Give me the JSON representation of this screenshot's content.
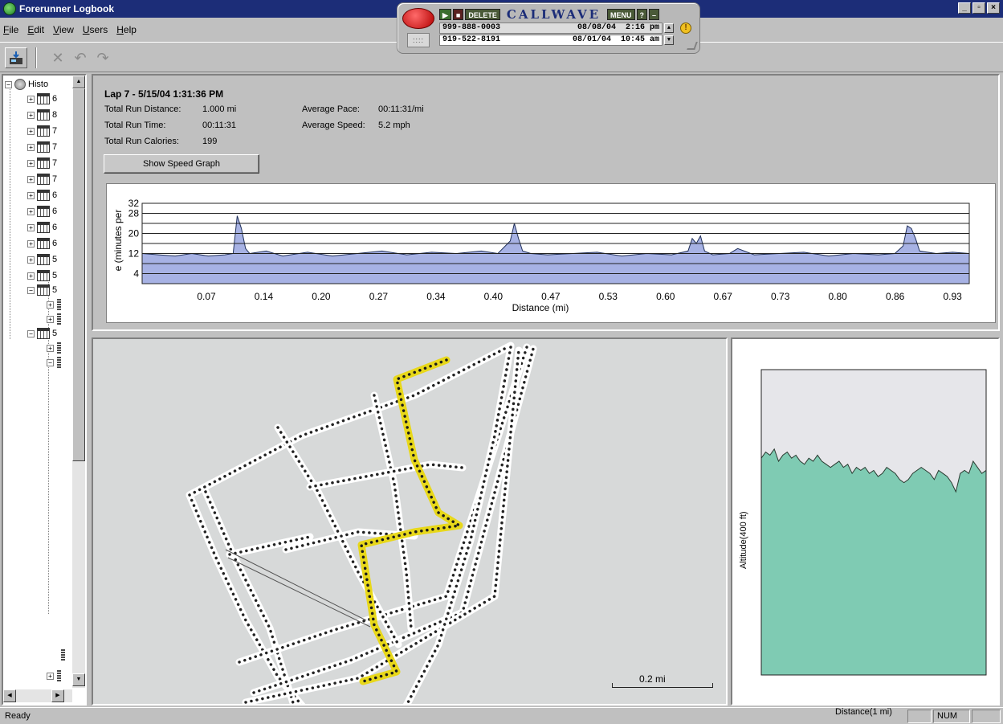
{
  "window": {
    "title": "Forerunner Logbook"
  },
  "menu": [
    {
      "u": "F",
      "rest": "ile"
    },
    {
      "u": "E",
      "rest": "dit"
    },
    {
      "u": "V",
      "rest": "iew"
    },
    {
      "u": "U",
      "rest": "sers"
    },
    {
      "u": "H",
      "rest": "elp"
    }
  ],
  "callwave": {
    "brand": "CALLWAVE",
    "delete_label": "DELETE",
    "menu_label": "MENU",
    "help_label": "?",
    "calls": [
      {
        "number": "999-888-0003",
        "date": "08/08/04",
        "time": "2:16 pm"
      },
      {
        "number": "919-522-8191",
        "date": "08/01/04",
        "time": "10:45 am"
      }
    ]
  },
  "tree": {
    "root_label": "Histo",
    "item_glyphs": [
      "6",
      "8",
      "7",
      "7",
      "7",
      "7",
      "6",
      "6",
      "6",
      "6",
      "5",
      "5",
      "5",
      "5"
    ]
  },
  "lap": {
    "title": "Lap 7 - 5/15/04 1:31:36 PM",
    "total_distance_label": "Total Run Distance:",
    "total_distance_value": "1.000 mi",
    "total_time_label": "Total Run Time:",
    "total_time_value": "00:11:31",
    "total_calories_label": "Total Run Calories:",
    "total_calories_value": "199",
    "avg_pace_label": "Average Pace:",
    "avg_pace_value": "00:11:31/mi",
    "avg_speed_label": "Average Speed:",
    "avg_speed_value": "5.2 mph",
    "show_graph_button": "Show Speed Graph"
  },
  "chart_data": {
    "type": "area",
    "xlabel": "Distance (mi)",
    "ylabel": "e (minutes per",
    "y_ticks": [
      4,
      12,
      20,
      28,
      32
    ],
    "ylim": [
      0,
      32
    ],
    "x_ticks": [
      "0.07",
      "0.14",
      "0.20",
      "0.27",
      "0.34",
      "0.40",
      "0.47",
      "0.53",
      "0.60",
      "0.67",
      "0.73",
      "0.80",
      "0.86",
      "0.93"
    ],
    "xlim": [
      0,
      1.0
    ],
    "fill_color": "#a7b2e4",
    "line_color": "#20305a",
    "x": [
      0.0,
      0.02,
      0.04,
      0.06,
      0.08,
      0.1,
      0.11,
      0.115,
      0.12,
      0.125,
      0.13,
      0.15,
      0.17,
      0.2,
      0.23,
      0.26,
      0.29,
      0.32,
      0.35,
      0.38,
      0.41,
      0.43,
      0.445,
      0.45,
      0.455,
      0.46,
      0.47,
      0.49,
      0.52,
      0.55,
      0.58,
      0.61,
      0.64,
      0.66,
      0.665,
      0.67,
      0.675,
      0.68,
      0.69,
      0.71,
      0.72,
      0.74,
      0.77,
      0.8,
      0.83,
      0.86,
      0.89,
      0.91,
      0.92,
      0.925,
      0.93,
      0.935,
      0.94,
      0.96,
      0.98,
      1.0
    ],
    "y": [
      12,
      11.5,
      11,
      12,
      11,
      11.5,
      12,
      27,
      22,
      14,
      12,
      13,
      11,
      12.5,
      11,
      12,
      13,
      11.5,
      12.5,
      12,
      13,
      12,
      17,
      24,
      18,
      13,
      12,
      11.5,
      12,
      12.5,
      11,
      12,
      11.5,
      13,
      18,
      16,
      19,
      13,
      11.5,
      12,
      14,
      11.5,
      12,
      12.5,
      11,
      12,
      11.5,
      12,
      15,
      23,
      22,
      18,
      13,
      12,
      12.5,
      12
    ]
  },
  "map": {
    "scale_label": "0.2 mi",
    "route_color": "#e8d81a",
    "track_color": "#222222"
  },
  "altitude": {
    "xlabel": "Distance(1 mi)",
    "ylabel": "Altitude(400 ft)",
    "fill_color": "#7fcbb3",
    "profile": [
      0.71,
      0.73,
      0.72,
      0.74,
      0.7,
      0.72,
      0.73,
      0.71,
      0.72,
      0.7,
      0.69,
      0.71,
      0.7,
      0.72,
      0.7,
      0.69,
      0.68,
      0.69,
      0.7,
      0.68,
      0.69,
      0.66,
      0.68,
      0.67,
      0.68,
      0.66,
      0.67,
      0.65,
      0.66,
      0.68,
      0.67,
      0.66,
      0.64,
      0.63,
      0.64,
      0.66,
      0.67,
      0.68,
      0.67,
      0.66,
      0.64,
      0.67,
      0.66,
      0.65,
      0.63,
      0.6,
      0.66,
      0.67,
      0.66,
      0.7,
      0.68,
      0.66,
      0.67
    ]
  },
  "status": {
    "text": "Ready",
    "num": "NUM"
  }
}
